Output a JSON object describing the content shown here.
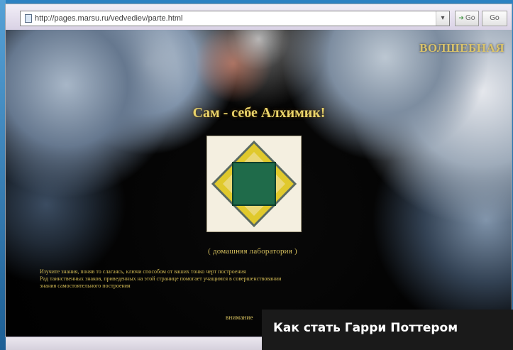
{
  "browser": {
    "address_value": "http://pages.marsu.ru/vedvediev/parte.html",
    "go_label": "Go",
    "search_label": "Go"
  },
  "page": {
    "banner_title": "ВОЛШЕБНАЯ",
    "title": "Сам - себе Алхимик!",
    "subtitle": "( домашняя лаборатория )",
    "body_lines": [
      "Изучите знания, поняв то слагаясь, ключи способом от ваших тонко черт        построения",
      "Рад таинственных знаков, приведенных на этой странице помогает учащимся в              совершенствовании",
      "знания самостоятельного построения"
    ],
    "more_label": "внимание",
    "caption": "Как стать Гарри Поттером"
  },
  "colors": {
    "gold": "#e9d36a",
    "emblem_yellow": "#e0c92c",
    "emblem_green": "#1f6b4a",
    "caption_bg": "#1a1a1a"
  },
  "icons": {
    "page": "page-icon",
    "dropdown": "chevron-down-icon",
    "go": "go-arrow-icon"
  }
}
